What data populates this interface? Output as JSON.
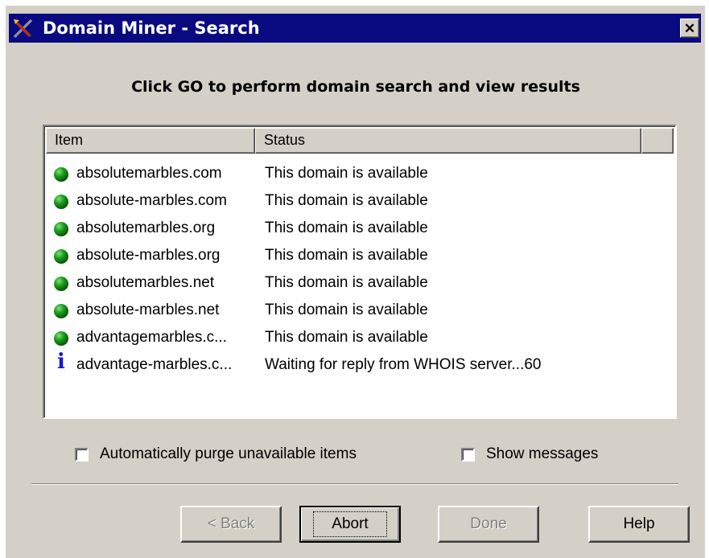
{
  "window": {
    "title": "Domain Miner - Search",
    "title_icon": "domain-miner-pickaxe-icon",
    "close_glyph": "✕",
    "titlebar_color": "#0a0a80",
    "face_color": "#d4d0c8"
  },
  "instruction": "Click GO to perform domain search and view results",
  "list": {
    "columns": [
      "Item",
      "Status"
    ],
    "rows": [
      {
        "icon": "green-globe-icon",
        "item": "absolutemarbles.com",
        "status": "This domain is available"
      },
      {
        "icon": "green-globe-icon",
        "item": "absolute-marbles.com",
        "status": "This domain is available"
      },
      {
        "icon": "green-globe-icon",
        "item": "absolutemarbles.org",
        "status": "This domain is available"
      },
      {
        "icon": "green-globe-icon",
        "item": "absolute-marbles.org",
        "status": "This domain is available"
      },
      {
        "icon": "green-globe-icon",
        "item": "absolutemarbles.net",
        "status": "This domain is available"
      },
      {
        "icon": "green-globe-icon",
        "item": "absolute-marbles.net",
        "status": "This domain is available"
      },
      {
        "icon": "green-globe-icon",
        "item": "advantagemarbles.c...",
        "status": "This domain is available"
      },
      {
        "icon": "info-icon",
        "item": "advantage-marbles.c...",
        "status": "Waiting for reply from WHOIS server...60",
        "info_glyph": "i"
      }
    ]
  },
  "options": {
    "purge_label": "Automatically purge unavailable items",
    "purge_checked": false,
    "messages_label": "Show messages",
    "messages_checked": false
  },
  "buttons": {
    "back_label": "< Back",
    "abort_label": "Abort",
    "done_label": "Done",
    "help_label": "Help"
  }
}
